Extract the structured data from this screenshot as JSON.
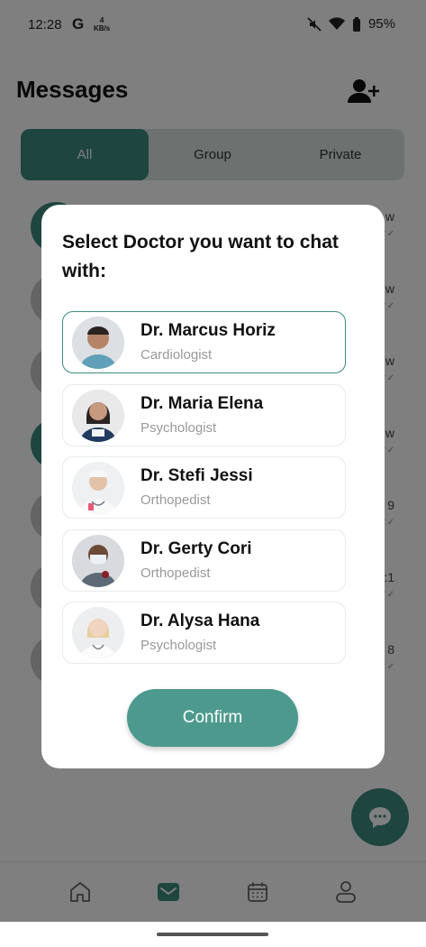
{
  "status_bar": {
    "time": "12:28",
    "g": "G",
    "kbs_value": "4",
    "kbs_unit": "KB/s",
    "battery": "95%"
  },
  "header": {
    "title": "Messages",
    "add_icon": "add-user-icon"
  },
  "tabs": [
    {
      "label": "All",
      "active": true
    },
    {
      "label": "Group",
      "active": false
    },
    {
      "label": "Private",
      "active": false
    }
  ],
  "chat_list": [
    {
      "time": "w"
    },
    {
      "time": "w"
    },
    {
      "time": "w"
    },
    {
      "time": "w"
    },
    {
      "time": "9"
    },
    {
      "time": ":1"
    },
    {
      "time": "8"
    }
  ],
  "modal": {
    "title": "Select Doctor you want to chat with:",
    "doctors": [
      {
        "name": "Dr. Marcus Horiz",
        "specialty": "Cardiologist",
        "selected": true
      },
      {
        "name": "Dr. Maria Elena",
        "specialty": "Psychologist",
        "selected": false
      },
      {
        "name": "Dr. Stefi Jessi",
        "specialty": "Orthopedist",
        "selected": false
      },
      {
        "name": "Dr. Gerty Cori",
        "specialty": "Orthopedist",
        "selected": false
      },
      {
        "name": "Dr. Alysa Hana",
        "specialty": "Psychologist",
        "selected": false
      }
    ],
    "confirm_label": "Confirm"
  },
  "bottom_nav": [
    "home-icon",
    "message-icon",
    "calendar-icon",
    "profile-icon"
  ],
  "colors": {
    "accent": "#3d8a7e",
    "tab_bg": "#d9e4e1",
    "button": "#4c9a8d"
  }
}
